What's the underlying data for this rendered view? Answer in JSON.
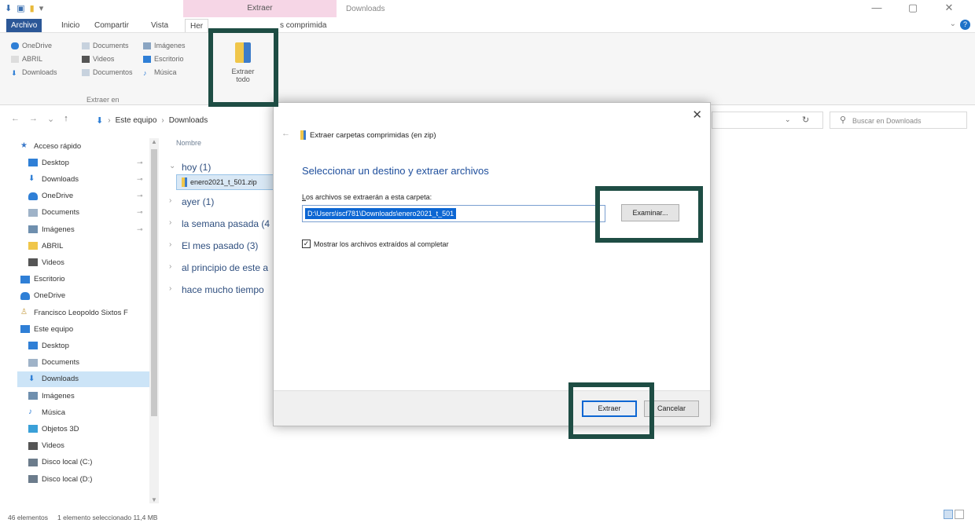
{
  "window": {
    "title": "Downloads",
    "context_tab_title": "Extraer",
    "controls": [
      "—",
      "▢",
      "✕"
    ]
  },
  "ribbon_tabs": {
    "file": "Archivo",
    "home": "Inicio",
    "share": "Compartir",
    "view": "Vista",
    "context_partial": "Her",
    "context_suffix": "s comprimida"
  },
  "ribbon": {
    "col1": [
      "OneDrive",
      "ABRIL",
      "Downloads"
    ],
    "col2": [
      "Documents",
      "Videos",
      "Documentos"
    ],
    "col3": [
      "Imágenes",
      "Escritorio",
      "Música"
    ],
    "group_label": "Extraer en",
    "extract_all_line1": "Extraer",
    "extract_all_line2": "todo"
  },
  "address": {
    "crumb1": "Este equipo",
    "crumb2": "Downloads",
    "search_placeholder": "Buscar en Downloads"
  },
  "navpane": {
    "items": [
      {
        "label": "Acceso rápido",
        "icon": "star-icon",
        "color": "#3a78c9"
      },
      {
        "label": "Desktop",
        "icon": "desktop-folder-icon",
        "color": "#2f7fd6",
        "pin": true
      },
      {
        "label": "Downloads",
        "icon": "download-icon",
        "color": "#2f7fd6",
        "pin": true
      },
      {
        "label": "OneDrive",
        "icon": "cloud-icon",
        "color": "#2f7fd6",
        "pin": true
      },
      {
        "label": "Documents",
        "icon": "document-icon",
        "color": "#9fb3c8",
        "pin": true
      },
      {
        "label": "Imágenes",
        "icon": "pictures-icon",
        "color": "#6f8fae",
        "pin": true
      },
      {
        "label": "ABRIL",
        "icon": "folder-icon",
        "color": "#f0c64a"
      },
      {
        "label": "Videos",
        "icon": "videos-icon",
        "color": "#555555"
      },
      {
        "label": "Escritorio",
        "icon": "desktop-folder-icon",
        "color": "#2f7fd6"
      },
      {
        "label": "OneDrive",
        "icon": "cloud-icon",
        "color": "#2f7fd6"
      },
      {
        "label": "Francisco Leopoldo Sixtos F",
        "icon": "user-icon",
        "color": "#c8a04a"
      },
      {
        "label": "Este equipo",
        "icon": "computer-icon",
        "color": "#2f7fd6"
      },
      {
        "label": "Desktop",
        "icon": "desktop-folder-icon",
        "color": "#2f7fd6"
      },
      {
        "label": "Documents",
        "icon": "document-icon",
        "color": "#9fb3c8"
      },
      {
        "label": "Downloads",
        "icon": "download-icon",
        "color": "#2f7fd6",
        "selected": true
      },
      {
        "label": "Imágenes",
        "icon": "pictures-icon",
        "color": "#6f8fae"
      },
      {
        "label": "Música",
        "icon": "music-icon",
        "color": "#2f7fd6"
      },
      {
        "label": "Objetos 3D",
        "icon": "cube-icon",
        "color": "#3aa0d8"
      },
      {
        "label": "Videos",
        "icon": "videos-icon",
        "color": "#555555"
      },
      {
        "label": "Disco local (C:)",
        "icon": "drive-icon",
        "color": "#6c7c8c"
      },
      {
        "label": "Disco local (D:)",
        "icon": "drive-icon",
        "color": "#6c7c8c"
      }
    ]
  },
  "filelist": {
    "column_header": "Nombre",
    "groups": [
      "hoy (1)",
      "ayer (1)",
      "la semana pasada (4",
      "El mes pasado (3)",
      "al principio de este a",
      "hace mucho tiempo"
    ],
    "selected_file": "enero2021_t_501.zip"
  },
  "status": {
    "count": "46 elementos",
    "selection": "1 elemento seleccionado  11,4 MB"
  },
  "dialog": {
    "header": "Extraer carpetas comprimidas (en zip)",
    "instruction": "Seleccionar un destino y extraer archivos",
    "label_prefix": "L",
    "label_rest": "os archivos se extraerán a esta carpeta:",
    "path": "D:\\Users\\iscf781\\Downloads\\enero2021_t_501",
    "browse": "Examinar...",
    "checkbox_label": "Mostrar los archivos extraídos al completar",
    "checkbox_checked": true,
    "extract": "Extraer",
    "cancel": "Cancelar"
  }
}
